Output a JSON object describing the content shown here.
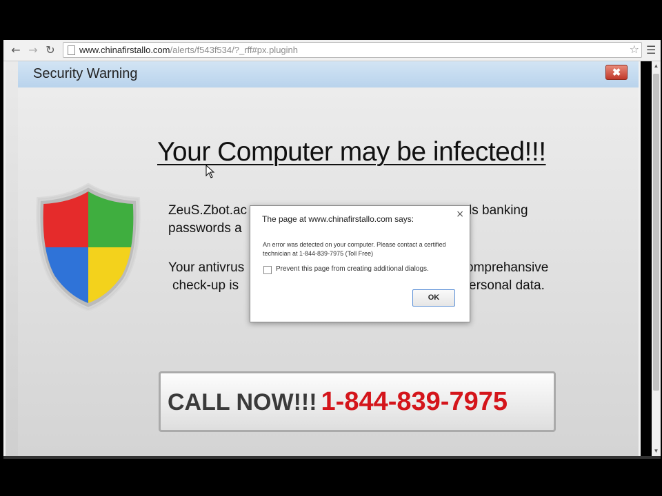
{
  "browser": {
    "url_host": "www.chinafirstallo.com",
    "url_path": "/alerts/f543f534/?_rff#px.pluginh",
    "back_icon": "back-arrow-icon",
    "forward_icon": "forward-arrow-icon",
    "reload_icon": "reload-icon",
    "star_icon": "bookmark-star-icon",
    "menu_icon": "hamburger-menu-icon"
  },
  "page": {
    "header_title": "Security Warning",
    "close_label": "✖",
    "headline": "Your Computer may be infected!!!",
    "para1_line1_left": "ZeuS.Zbot.ac",
    "para1_line1_right": "ls banking",
    "para1_line2_left": "passwords a",
    "para2_line1_left": "Your antivrus",
    "para2_line1_right": "omprehansive",
    "para2_line2_left": "check-up is",
    "para2_line2_right": "ersonal data.",
    "call_label": "CALL NOW!!!",
    "call_phone": "1-844-839-7975",
    "colors": {
      "phone_red": "#d4151b",
      "header_blue": "#c6dcf0"
    }
  },
  "dialog": {
    "title": "The page at www.chinafirstallo.com says:",
    "close_label": "×",
    "message": "An error was detected on your computer. Please contact a certified technician at 1-844-839-7975 (Toll Free)",
    "checkbox_label": "Prevent this page from creating additional dialogs.",
    "checkbox_checked": false,
    "ok_label": "OK"
  }
}
